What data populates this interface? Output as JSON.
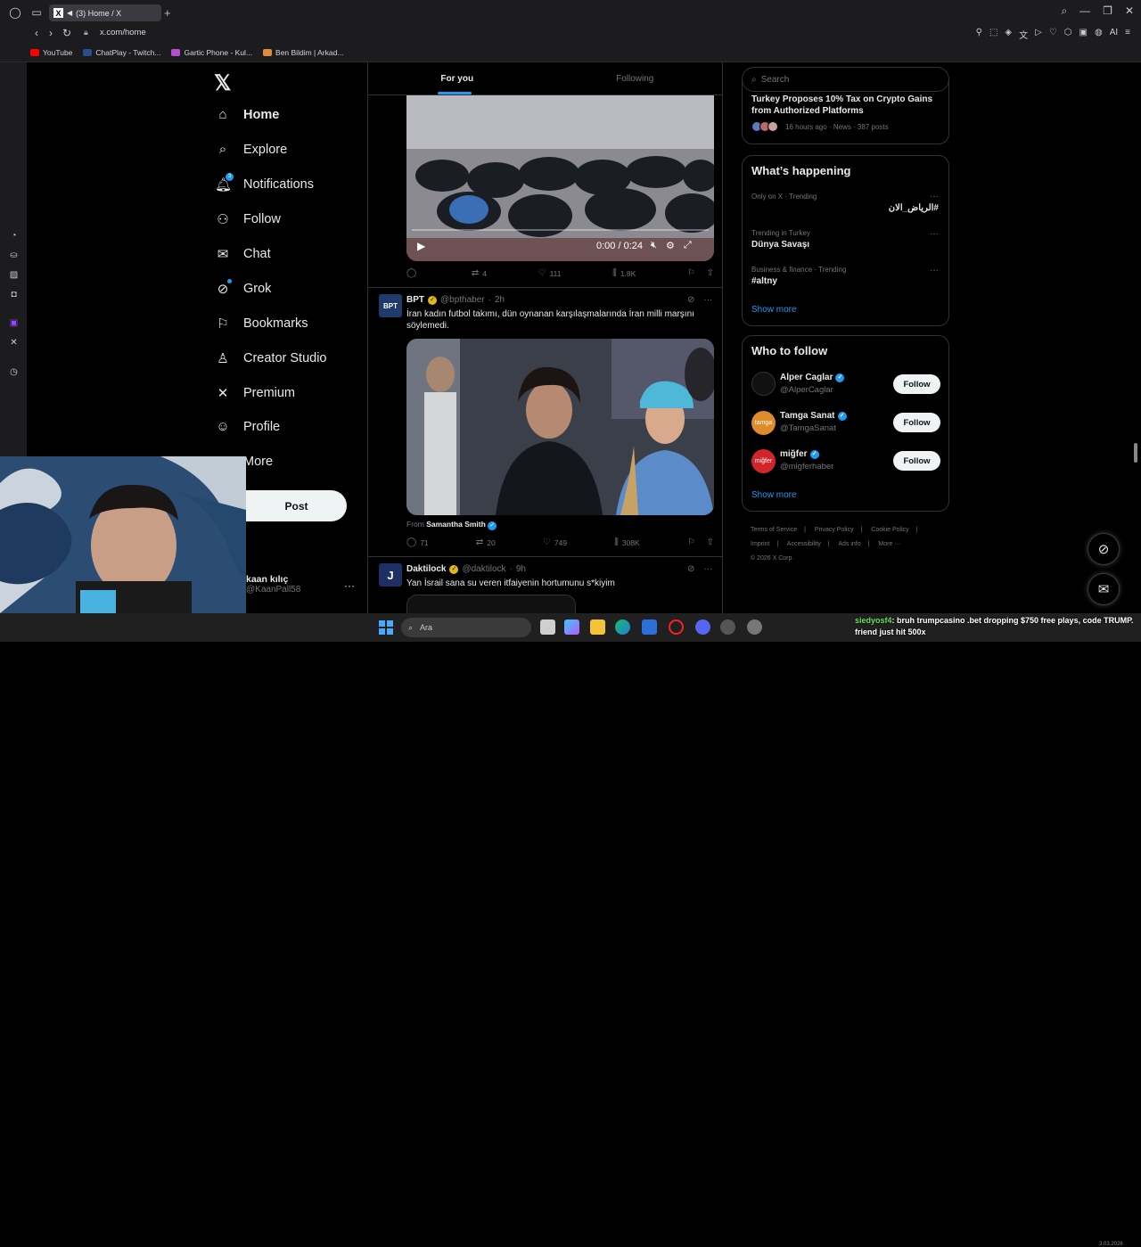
{
  "browser": {
    "tab_title": "(3) Home / X",
    "url": "x.com/home",
    "bookmarks": [
      "YouTube",
      "ChatPlay - Twitch...",
      "Gartic Phone - Kul...",
      "Ben Bildim | Arkad..."
    ],
    "ext_label": "AI"
  },
  "nav": {
    "items": [
      {
        "label": "Home",
        "icon": "home-icon"
      },
      {
        "label": "Explore",
        "icon": "search-icon"
      },
      {
        "label": "Notifications",
        "icon": "bell-icon",
        "badge": "3"
      },
      {
        "label": "Follow",
        "icon": "add-user-icon"
      },
      {
        "label": "Chat",
        "icon": "mail-icon"
      },
      {
        "label": "Grok",
        "icon": "grok-icon"
      },
      {
        "label": "Bookmarks",
        "icon": "bookmark-icon"
      },
      {
        "label": "Creator Studio",
        "icon": "creator-icon"
      },
      {
        "label": "Premium",
        "icon": "x-icon"
      },
      {
        "label": "Profile",
        "icon": "person-icon"
      },
      {
        "label": "More",
        "icon": "more-icon"
      }
    ],
    "post_label": "Post",
    "profile_name": "kaan kılıç",
    "profile_handle": "@KaanPall58"
  },
  "timeline": {
    "tabs": [
      "For you",
      "Following"
    ],
    "video": {
      "time": "0:00 / 0:24"
    },
    "tweet1_actions": {
      "replies": "",
      "reposts": "4",
      "likes": "111",
      "views": "1.8K"
    },
    "tweet2": {
      "name": "BPT",
      "handle": "@bpthaber",
      "time": "2h",
      "text": "İran kadın futbol takımı, dün oynanan karşılaşmalarında İran milli marşını söylemedi.",
      "from_label": "From",
      "from_name": "Samantha Smith",
      "replies": "71",
      "reposts": "20",
      "likes": "749",
      "views": "308K"
    },
    "tweet3": {
      "name": "Daktilock",
      "handle": "@daktilock",
      "time": "9h",
      "text": "Yan İsrail sana su veren itfaiyenin hortumunu s*kiyim"
    }
  },
  "right": {
    "search_placeholder": "Search",
    "news": {
      "title": "Turkey Proposes 10% Tax on Crypto Gains from Authorized Platforms",
      "meta": "16 hours ago · News · 387 posts"
    },
    "happening_title": "What’s happening",
    "trends": [
      {
        "category": "Only on X · Trending",
        "name": "#الرياض_الان"
      },
      {
        "category": "Trending in Turkey",
        "name": "Dünya Savaşı"
      },
      {
        "category": "Business & finance · Trending",
        "name": "#altny"
      }
    ],
    "show_more": "Show more",
    "wtf_title": "Who to follow",
    "follow_label": "Follow",
    "suggestions": [
      {
        "name": "Alper Caglar",
        "handle": "@AlperCaglar"
      },
      {
        "name": "Tamga Sanat",
        "handle": "@TamgaSanat"
      },
      {
        "name": "miğfer",
        "handle": "@migferhaber"
      }
    ],
    "footer": [
      "Terms of Service",
      "|",
      "Privacy Policy",
      "|",
      "Cookie Policy",
      "|",
      "Imprint",
      "|",
      "Accessibility",
      "|",
      "Ads info",
      "|",
      "More ···",
      "© 2026 X Corp."
    ]
  },
  "taskbar": {
    "search_label": "Ara",
    "clock": "3.03.2026"
  },
  "stream_chat": {
    "user": "siedyosf4",
    "message": ": bruh trumpcasino .bet dropping $750 free plays, code TRUMP. friend just hit 500x"
  },
  "colors": {
    "accent": "#1d9bf0",
    "background": "#000000",
    "border": "#2f3336",
    "muted": "#71767b"
  }
}
